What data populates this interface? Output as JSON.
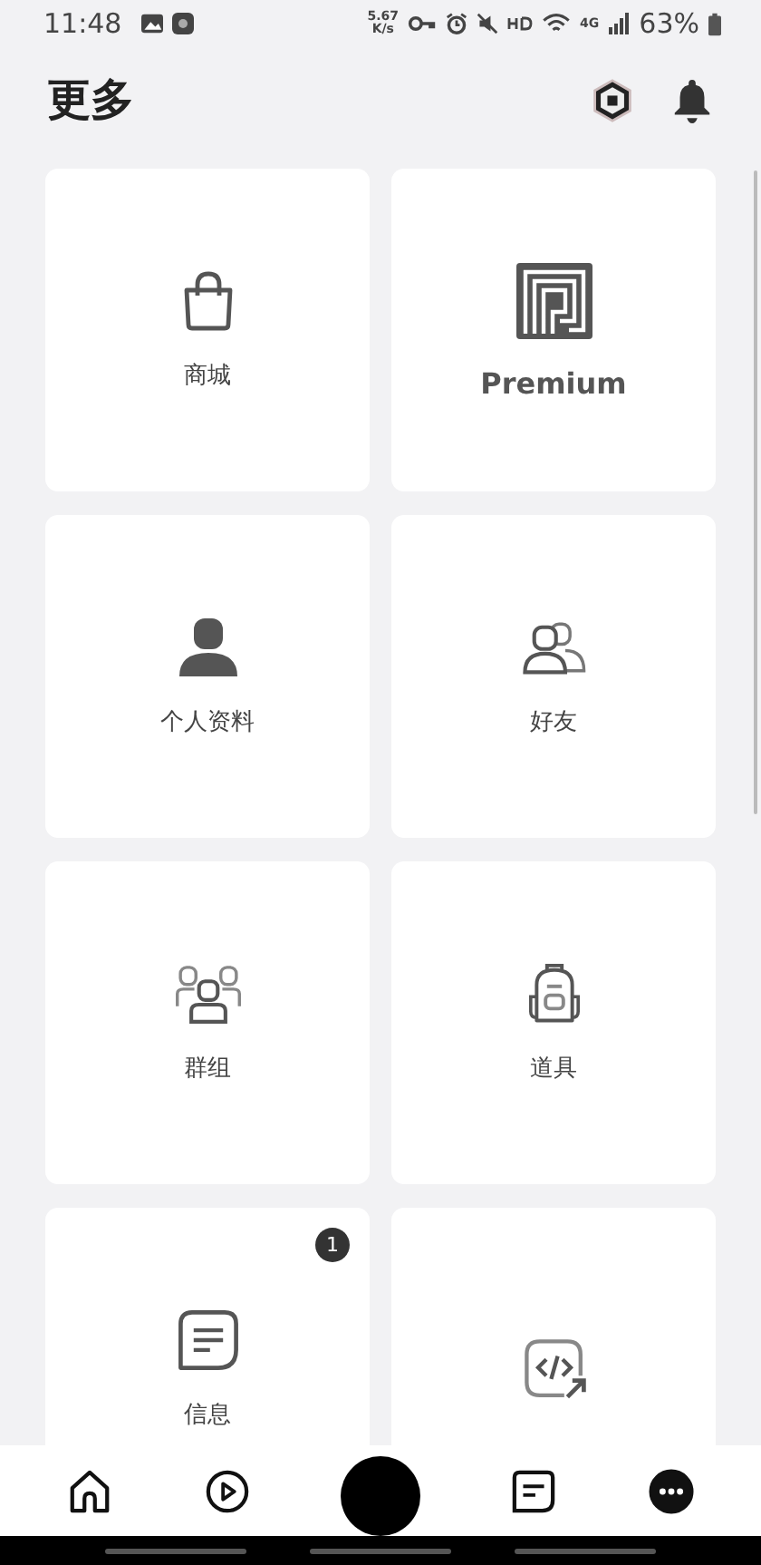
{
  "status_bar": {
    "time": "11:48",
    "speed": "5.67\nK/s",
    "network": "4G",
    "battery": "63%"
  },
  "header": {
    "title": "更多"
  },
  "tiles": [
    {
      "kind": "shop",
      "label": "商城"
    },
    {
      "kind": "premium",
      "label": "Premium"
    },
    {
      "kind": "profile",
      "label": "个人资料"
    },
    {
      "kind": "friends",
      "label": "好友"
    },
    {
      "kind": "groups",
      "label": "群组"
    },
    {
      "kind": "inventory",
      "label": "道具"
    },
    {
      "kind": "messages",
      "label": "信息",
      "badge": "1"
    },
    {
      "kind": "creator"
    }
  ],
  "nav": [
    {
      "kind": "home",
      "selected": false
    },
    {
      "kind": "play",
      "selected": false
    },
    {
      "kind": "avatar",
      "selected": false
    },
    {
      "kind": "chat",
      "selected": false
    },
    {
      "kind": "more",
      "selected": true
    }
  ]
}
